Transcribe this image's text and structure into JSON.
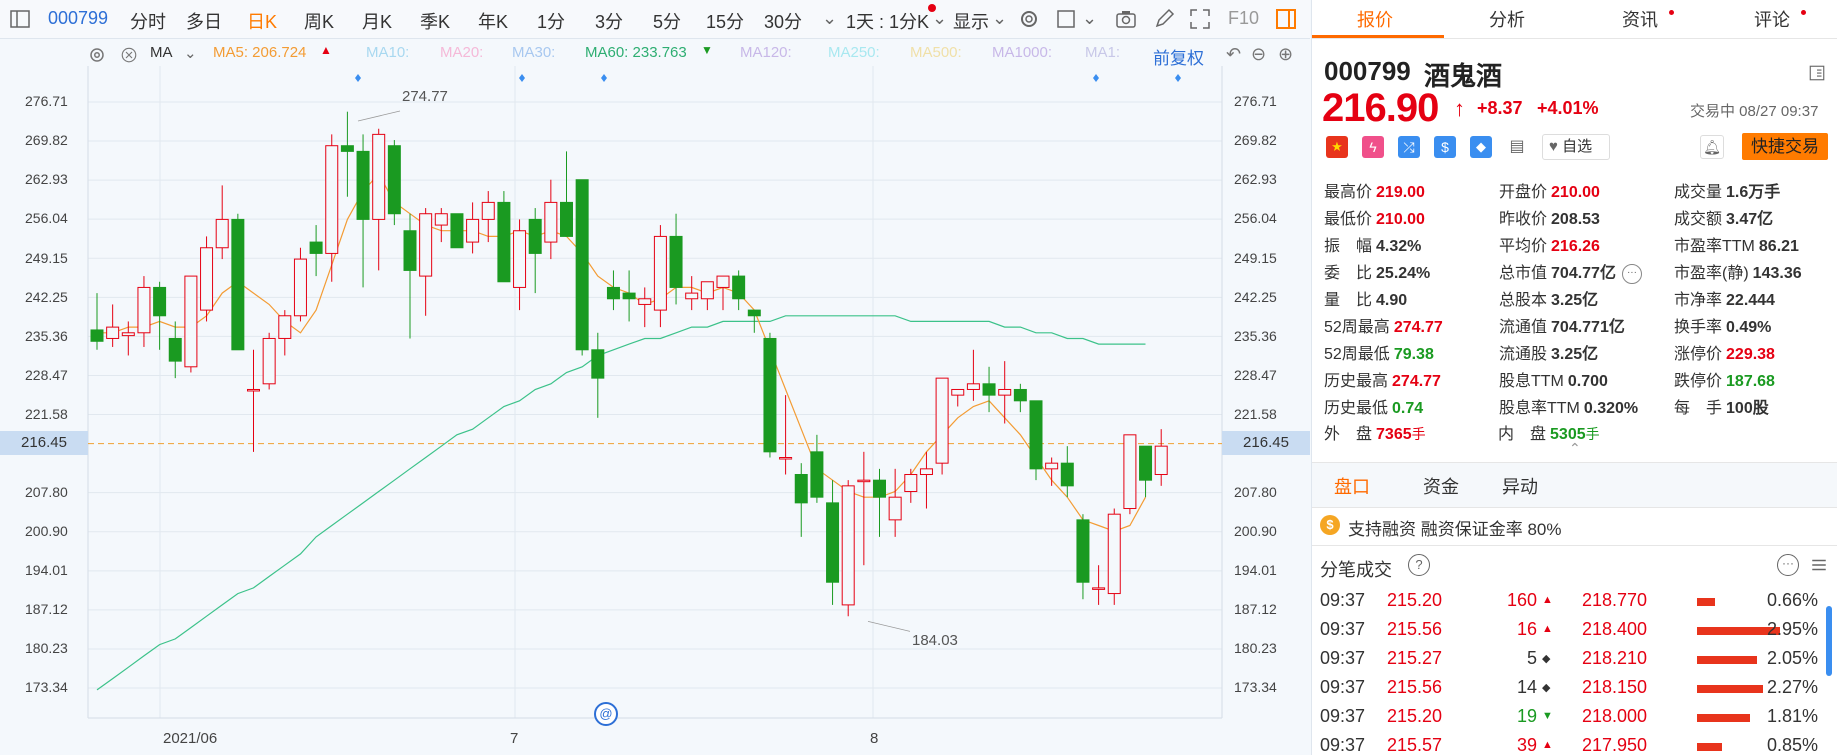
{
  "toolbar": {
    "code": "000799",
    "tabs": [
      "分时",
      "多日",
      "日K",
      "周K",
      "月K",
      "季K",
      "年K",
      "1分",
      "3分",
      "5分",
      "15分",
      "30分"
    ],
    "active_tab": "日K",
    "period_select": "1天 : 1分K",
    "display_label": "显示",
    "f10_label": "F10"
  },
  "ma_bar": {
    "label": "MA",
    "ma5": "MA5: 206.724",
    "ma10": "MA10:",
    "ma20": "MA20:",
    "ma30": "MA30:",
    "ma60": "MA60: 233.763",
    "ma120": "MA120:",
    "ma250": "MA250:",
    "ma500": "MA500:",
    "ma1000": "MA1000:",
    "ma1": "MA1:",
    "adjust": "前复权"
  },
  "chart": {
    "y_ticks": [
      "276.71",
      "269.82",
      "262.93",
      "256.04",
      "249.15",
      "242.25",
      "235.36",
      "228.47",
      "221.58",
      "207.80",
      "200.90",
      "194.01",
      "187.12",
      "180.23",
      "173.34"
    ],
    "current_price_label": "216.45",
    "high_annotation": "274.77",
    "low_annotation": "184.03",
    "x_labels": [
      "2021/06",
      "7",
      "8"
    ],
    "colors": {
      "up": "#e50012",
      "down": "#1a9a21",
      "ma5": "#f39c34",
      "ma60": "#3cc28a"
    }
  },
  "chart_data": {
    "type": "candlestick",
    "y_range": [
      170,
      280
    ],
    "candles": [
      {
        "o": 236.5,
        "h": 243,
        "l": 233,
        "c": 234.5
      },
      {
        "o": 235,
        "h": 241,
        "l": 233.5,
        "c": 237
      },
      {
        "o": 235.5,
        "h": 238,
        "l": 232,
        "c": 236
      },
      {
        "o": 236,
        "h": 246,
        "l": 233.5,
        "c": 244
      },
      {
        "o": 244,
        "h": 245,
        "l": 233,
        "c": 239
      },
      {
        "o": 235,
        "h": 238,
        "l": 228,
        "c": 231
      },
      {
        "o": 230,
        "h": 245,
        "l": 229,
        "c": 246
      },
      {
        "o": 240,
        "h": 253,
        "l": 238,
        "c": 251
      },
      {
        "o": 251,
        "h": 262,
        "l": 249,
        "c": 256
      },
      {
        "o": 256,
        "h": 257,
        "l": 233,
        "c": 233
      },
      {
        "o": 226,
        "h": 233,
        "l": 215,
        "c": 226
      },
      {
        "o": 227,
        "h": 236,
        "l": 226,
        "c": 235
      },
      {
        "o": 235,
        "h": 240,
        "l": 232,
        "c": 239
      },
      {
        "o": 239,
        "h": 251,
        "l": 238,
        "c": 249
      },
      {
        "o": 252,
        "h": 255,
        "l": 246,
        "c": 250
      },
      {
        "o": 250,
        "h": 271,
        "l": 245,
        "c": 269
      },
      {
        "o": 269,
        "h": 275,
        "l": 260,
        "c": 268
      },
      {
        "o": 268,
        "h": 271,
        "l": 244,
        "c": 256
      },
      {
        "o": 256,
        "h": 272,
        "l": 247,
        "c": 271
      },
      {
        "o": 269,
        "h": 270,
        "l": 255,
        "c": 257
      },
      {
        "o": 254,
        "h": 257,
        "l": 235,
        "c": 247
      },
      {
        "o": 246,
        "h": 258,
        "l": 239,
        "c": 257
      },
      {
        "o": 255,
        "h": 258,
        "l": 252,
        "c": 257
      },
      {
        "o": 257,
        "h": 257,
        "l": 251,
        "c": 251
      },
      {
        "o": 252,
        "h": 259,
        "l": 250,
        "c": 256
      },
      {
        "o": 256,
        "h": 261,
        "l": 252,
        "c": 259
      },
      {
        "o": 259,
        "h": 261,
        "l": 245,
        "c": 245
      },
      {
        "o": 244,
        "h": 256,
        "l": 240,
        "c": 254
      },
      {
        "o": 256,
        "h": 258,
        "l": 243,
        "c": 250
      },
      {
        "o": 252,
        "h": 263,
        "l": 249,
        "c": 259
      },
      {
        "o": 259,
        "h": 268,
        "l": 253,
        "c": 253
      },
      {
        "o": 263,
        "h": 263,
        "l": 232,
        "c": 233
      },
      {
        "o": 233,
        "h": 236,
        "l": 221,
        "c": 228
      },
      {
        "o": 244,
        "h": 247,
        "l": 240,
        "c": 242
      },
      {
        "o": 243,
        "h": 247,
        "l": 238,
        "c": 242
      },
      {
        "o": 241,
        "h": 244,
        "l": 237,
        "c": 242
      },
      {
        "o": 240,
        "h": 255,
        "l": 237,
        "c": 253
      },
      {
        "o": 253,
        "h": 257,
        "l": 241,
        "c": 244
      },
      {
        "o": 242,
        "h": 246,
        "l": 240,
        "c": 243
      },
      {
        "o": 242,
        "h": 245,
        "l": 240,
        "c": 245
      },
      {
        "o": 244,
        "h": 246,
        "l": 240,
        "c": 246
      },
      {
        "o": 246,
        "h": 247,
        "l": 240,
        "c": 242
      },
      {
        "o": 240,
        "h": 240,
        "l": 236,
        "c": 239
      },
      {
        "o": 235,
        "h": 236,
        "l": 214,
        "c": 215
      },
      {
        "o": 214,
        "h": 225,
        "l": 211,
        "c": 214
      },
      {
        "o": 211,
        "h": 213,
        "l": 200,
        "c": 206
      },
      {
        "o": 215,
        "h": 218,
        "l": 206,
        "c": 207
      },
      {
        "o": 206,
        "h": 210,
        "l": 188,
        "c": 192
      },
      {
        "o": 188,
        "h": 210,
        "l": 186,
        "c": 209
      },
      {
        "o": 210,
        "h": 215,
        "l": 195,
        "c": 210
      },
      {
        "o": 210,
        "h": 212,
        "l": 200,
        "c": 207
      },
      {
        "o": 203,
        "h": 212,
        "l": 200,
        "c": 207
      },
      {
        "o": 208,
        "h": 212,
        "l": 206,
        "c": 211
      },
      {
        "o": 211,
        "h": 215,
        "l": 205,
        "c": 212
      },
      {
        "o": 213,
        "h": 228,
        "l": 211,
        "c": 228
      },
      {
        "o": 225,
        "h": 226,
        "l": 223,
        "c": 226
      },
      {
        "o": 226,
        "h": 233,
        "l": 224,
        "c": 227
      },
      {
        "o": 227,
        "h": 230,
        "l": 222,
        "c": 225
      },
      {
        "o": 225,
        "h": 231,
        "l": 220,
        "c": 226
      },
      {
        "o": 226,
        "h": 227,
        "l": 222,
        "c": 224
      },
      {
        "o": 224,
        "h": 224,
        "l": 210,
        "c": 212
      },
      {
        "o": 212,
        "h": 214,
        "l": 209,
        "c": 213
      },
      {
        "o": 213,
        "h": 216,
        "l": 207,
        "c": 209
      },
      {
        "o": 203,
        "h": 204,
        "l": 189,
        "c": 192
      },
      {
        "o": 191,
        "h": 195,
        "l": 188,
        "c": 191
      },
      {
        "o": 190,
        "h": 205,
        "l": 188,
        "c": 204
      },
      {
        "o": 205,
        "h": 218,
        "l": 204,
        "c": 218
      },
      {
        "o": 216,
        "h": 216,
        "l": 207,
        "c": 210
      },
      {
        "o": 211,
        "h": 219,
        "l": 209,
        "c": 216
      }
    ],
    "ma5": [
      236,
      236,
      237,
      237,
      238,
      237,
      237,
      239,
      243,
      245,
      243,
      241,
      238,
      236,
      240,
      248,
      256,
      261,
      264,
      259,
      257,
      255,
      254,
      254,
      254,
      253,
      253,
      254,
      253,
      254,
      253,
      250,
      246,
      244,
      243,
      241,
      242,
      244,
      244,
      243,
      244,
      243,
      240,
      233,
      226,
      219,
      212,
      210,
      208,
      207,
      207,
      208,
      211,
      215,
      218,
      221,
      223,
      224,
      221,
      218,
      214,
      210,
      207,
      203,
      202,
      201,
      202,
      207
    ],
    "ma60": [
      173,
      175,
      177,
      179,
      181,
      182,
      184,
      186,
      188,
      190,
      191,
      193,
      195,
      197,
      200,
      202,
      204,
      206,
      208,
      210,
      212,
      214,
      216,
      218,
      219,
      221,
      223,
      224,
      226,
      227,
      229,
      230,
      232,
      233,
      234,
      235,
      235,
      236,
      237,
      237,
      238,
      238,
      238,
      238,
      239,
      239,
      239,
      239,
      239,
      239,
      239,
      239,
      238,
      238,
      238,
      238,
      238,
      238,
      237,
      237,
      236,
      236,
      235,
      235,
      234,
      234,
      234,
      234
    ]
  },
  "panel": {
    "tabs": [
      "报价",
      "分析",
      "资讯",
      "评论"
    ],
    "active_tab": "报价",
    "code": "000799",
    "name": "酒鬼酒",
    "price": "216.90",
    "change": "+8.37",
    "change_pct": "+4.01%",
    "status": "交易中 08/27 09:37",
    "watch_label": "自选",
    "quick_trade": "快捷交易",
    "stats": [
      [
        {
          "k": "最高价",
          "v": "219.00",
          "c": "red"
        },
        {
          "k": "开盘价",
          "v": "210.00",
          "c": "red"
        },
        {
          "k": "成交量",
          "v": "1.6万手",
          "c": "dark"
        }
      ],
      [
        {
          "k": "最低价",
          "v": "210.00",
          "c": "red"
        },
        {
          "k": "昨收价",
          "v": "208.53",
          "c": "dark"
        },
        {
          "k": "成交额",
          "v": "3.47亿",
          "c": "dark"
        }
      ],
      [
        {
          "k": "振　幅",
          "v": "4.32%",
          "c": "dark"
        },
        {
          "k": "平均价",
          "v": "216.26",
          "c": "red"
        },
        {
          "k": "市盈率TTM",
          "v": "86.21",
          "c": "dark"
        }
      ],
      [
        {
          "k": "委　比",
          "v": "25.24%",
          "c": "dark"
        },
        {
          "k": "总市值",
          "v": "704.77亿",
          "c": "dark"
        },
        {
          "k": "市盈率(静)",
          "v": "143.36",
          "c": "dark"
        }
      ],
      [
        {
          "k": "量　比",
          "v": "4.90",
          "c": "dark"
        },
        {
          "k": "总股本",
          "v": "3.25亿",
          "c": "dark"
        },
        {
          "k": "市净率",
          "v": "22.444",
          "c": "dark"
        }
      ],
      [
        {
          "k": "52周最高",
          "v": "274.77",
          "c": "red"
        },
        {
          "k": "流通值",
          "v": "704.771亿",
          "c": "dark"
        },
        {
          "k": "换手率",
          "v": "0.49%",
          "c": "dark"
        }
      ],
      [
        {
          "k": "52周最低",
          "v": "79.38",
          "c": "green"
        },
        {
          "k": "流通股",
          "v": "3.25亿",
          "c": "dark"
        },
        {
          "k": "涨停价",
          "v": "229.38",
          "c": "red"
        }
      ],
      [
        {
          "k": "历史最高",
          "v": "274.77",
          "c": "red"
        },
        {
          "k": "股息TTM",
          "v": "0.700",
          "c": "dark"
        },
        {
          "k": "跌停价",
          "v": "187.68",
          "c": "green"
        }
      ],
      [
        {
          "k": "历史最低",
          "v": "0.74",
          "c": "green"
        },
        {
          "k": "股息率TTM",
          "v": "0.320%",
          "c": "dark"
        },
        {
          "k": "每　手",
          "v": "100股",
          "c": "dark"
        }
      ]
    ],
    "outer_label": "外　盘",
    "outer_value": "7365",
    "inner_label": "内　盘",
    "inner_value": "5305",
    "hand_unit": "手",
    "sub_tabs": [
      "盘口",
      "资金",
      "异动"
    ],
    "active_sub_tab": "盘口",
    "margin_note": "支持融资 融资保证金率 80%",
    "trades_title": "分笔成交",
    "trades": [
      {
        "time": "09:37",
        "price": "215.20",
        "vol": "160",
        "dir": "up",
        "avg": "218.770",
        "pct": "0.66%",
        "bar": 0.2
      },
      {
        "time": "09:37",
        "price": "215.56",
        "vol": "16",
        "dir": "up",
        "avg": "218.400",
        "pct": "2.95%",
        "bar": 0.9
      },
      {
        "time": "09:37",
        "price": "215.27",
        "vol": "5",
        "dir": "flat",
        "avg": "218.210",
        "pct": "2.05%",
        "bar": 0.65
      },
      {
        "time": "09:37",
        "price": "215.56",
        "vol": "14",
        "dir": "flat",
        "avg": "218.150",
        "pct": "2.27%",
        "bar": 0.72
      },
      {
        "time": "09:37",
        "price": "215.20",
        "vol": "19",
        "dir": "down",
        "avg": "218.000",
        "pct": "1.81%",
        "bar": 0.58
      },
      {
        "time": "09:37",
        "price": "215.57",
        "vol": "39",
        "dir": "up",
        "avg": "217.950",
        "pct": "0.85%",
        "bar": 0.27
      }
    ]
  }
}
